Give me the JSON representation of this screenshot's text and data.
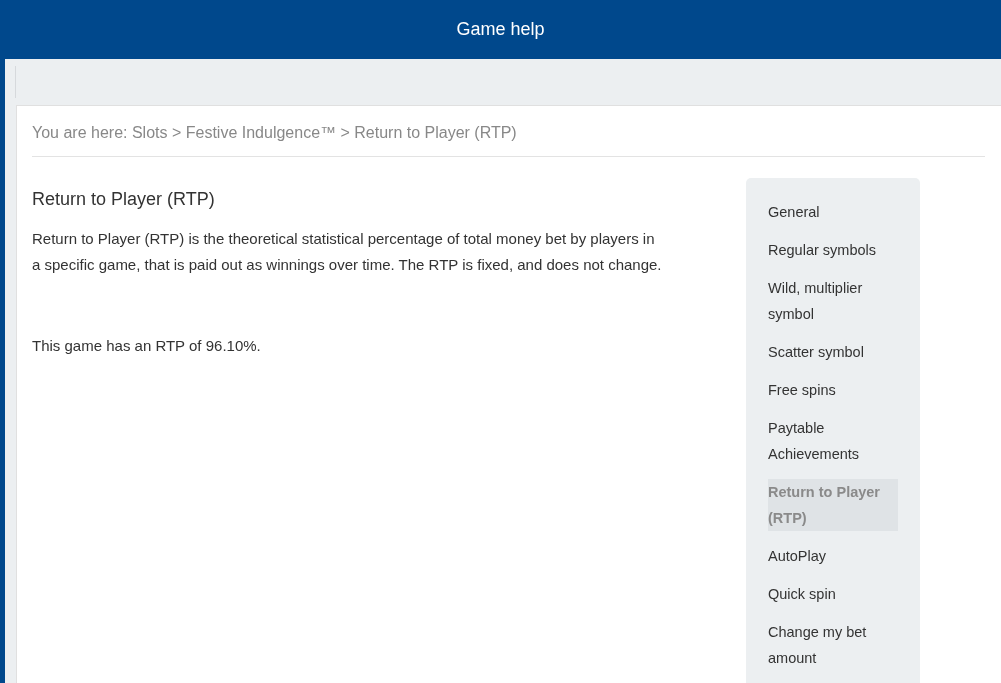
{
  "header": {
    "title": "Game help"
  },
  "breadcrumb": "You are here: Slots > Festive Indulgence™ > Return to Player (RTP)",
  "article": {
    "title": "Return to Player (RTP)",
    "paragraphs": [
      "Return to Player (RTP) is the theoretical statistical percentage of total money bet by players in a specific game, that is paid out as winnings over time. The RTP is fixed, and does not change.",
      "This game has an RTP of 96.10%."
    ]
  },
  "sidebar": {
    "items": [
      {
        "label": "General",
        "selected": false
      },
      {
        "label": "Regular symbols",
        "selected": false
      },
      {
        "label": "Wild, multiplier symbol",
        "selected": false
      },
      {
        "label": "Scatter symbol",
        "selected": false
      },
      {
        "label": "Free spins",
        "selected": false
      },
      {
        "label": "Paytable Achievements",
        "selected": false
      },
      {
        "label": "Return to Player (RTP)",
        "selected": true
      },
      {
        "label": "AutoPlay",
        "selected": false
      },
      {
        "label": "Quick spin",
        "selected": false
      },
      {
        "label": "Change my bet amount",
        "selected": false
      }
    ]
  }
}
